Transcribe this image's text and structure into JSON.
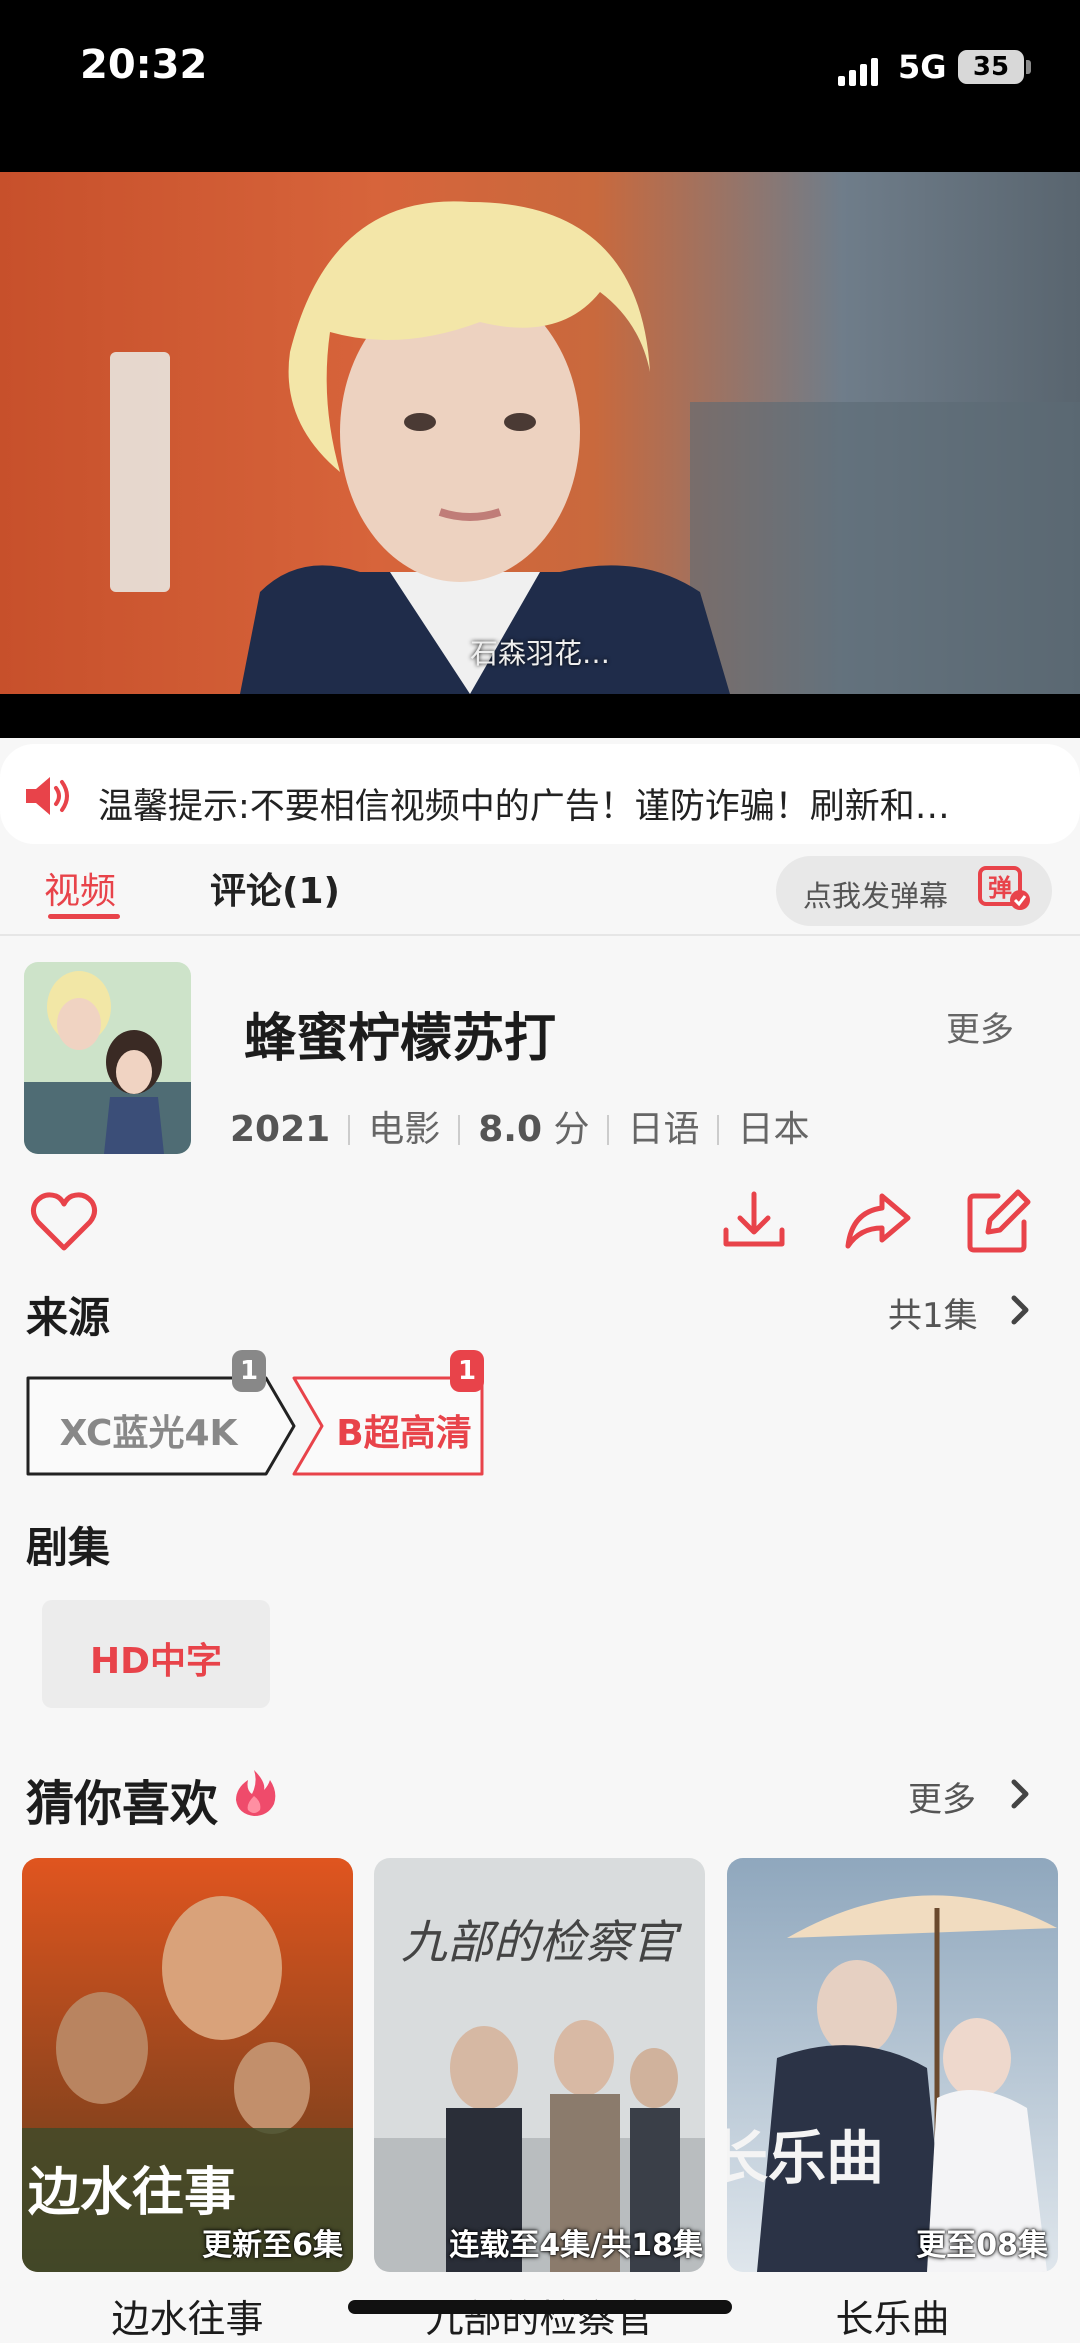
{
  "status": {
    "time": "20:32",
    "network": "5G",
    "battery": "35"
  },
  "video": {
    "subtitle": "石森羽花…"
  },
  "notice": {
    "text": "温馨提示:不要相信视频中的广告！谨防诈骗！刷新和…"
  },
  "tabs": [
    {
      "label": "视频"
    },
    {
      "label": "评论(1)"
    }
  ],
  "danmaku": {
    "label": "点我发弹幕",
    "icon_char": "弹"
  },
  "movie": {
    "title": "蜂蜜柠檬苏打",
    "more": "更多",
    "year": "2021",
    "type": "电影",
    "score": "8.0",
    "score_unit": "分",
    "language": "日语",
    "region": "日本"
  },
  "actions": {
    "icons": [
      "heart-icon",
      "download-icon",
      "share-icon",
      "edit-icon"
    ]
  },
  "source": {
    "title": "来源",
    "count_label": "共1集",
    "tags": [
      {
        "label": "XC蓝光4K",
        "badge": "1"
      },
      {
        "label": "B超高清",
        "badge": "1"
      }
    ]
  },
  "episodes": {
    "title": "剧集",
    "items": [
      {
        "label": "HD中字"
      }
    ]
  },
  "recommend": {
    "title": "猜你喜欢",
    "more": "更多",
    "items": [
      {
        "title": "边水往事",
        "badge": "更新至6集",
        "overlay": "边水往事"
      },
      {
        "title": "九部的检察官",
        "badge": "连载至4集/共18集",
        "overlay": "九部的检察官"
      },
      {
        "title": "长乐曲",
        "badge": "更至08集",
        "overlay": "长乐曲"
      }
    ]
  },
  "colors": {
    "accent": "#e8434a",
    "background": "#f7f7f7"
  }
}
